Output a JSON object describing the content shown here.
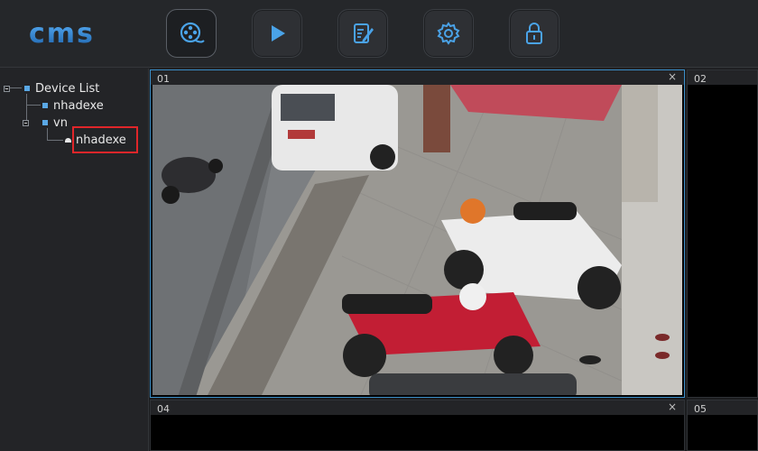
{
  "app": {
    "logo_text": "cms"
  },
  "toolbar": {
    "buttons": [
      {
        "name": "video-reel-icon",
        "active": true
      },
      {
        "name": "play-icon",
        "active": false
      },
      {
        "name": "edit-document-icon",
        "active": false
      },
      {
        "name": "gear-icon",
        "active": false
      },
      {
        "name": "lock-icon",
        "active": false
      }
    ]
  },
  "tree": {
    "root_label": "Device List",
    "items": [
      {
        "label": "nhadexe"
      },
      {
        "label": "vn",
        "children": [
          {
            "label": "nhadexe",
            "selected": true
          }
        ]
      }
    ]
  },
  "panes": [
    {
      "number": "01",
      "close": "×"
    },
    {
      "number": "02"
    },
    {
      "number": "04",
      "close": "×"
    },
    {
      "number": "05"
    }
  ],
  "colors": {
    "accent": "#3c8fc9",
    "highlight": "#e0262a",
    "tree_icon": "#5aa8e6"
  }
}
